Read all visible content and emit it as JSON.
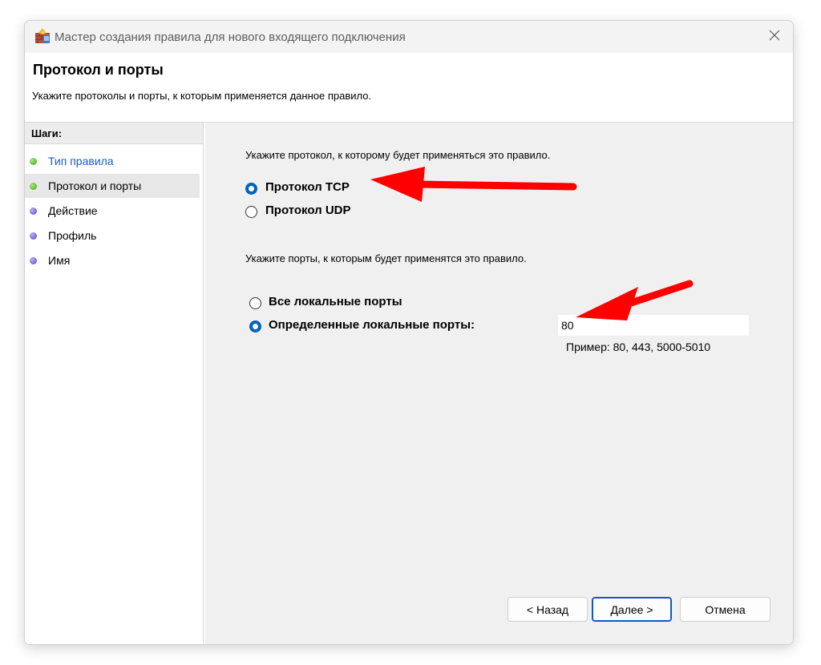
{
  "window": {
    "title": "Мастер создания правила для нового входящего подключения"
  },
  "header": {
    "title": "Протокол и порты",
    "description": "Укажите протоколы и порты, к которым применяется данное правило."
  },
  "sidebar": {
    "steps_label": "Шаги:",
    "items": [
      {
        "label": "Тип правила",
        "status": "done",
        "color": "#1a5fb4"
      },
      {
        "label": "Протокол и порты",
        "status": "current",
        "color": "#000000"
      },
      {
        "label": "Действие",
        "status": "pending",
        "color": "#000000"
      },
      {
        "label": "Профиль",
        "status": "pending",
        "color": "#000000"
      },
      {
        "label": "Имя",
        "status": "pending",
        "color": "#000000"
      }
    ]
  },
  "protocol": {
    "prompt": "Укажите протокол, к которому будет применяться это правило.",
    "options": [
      {
        "label": "Протокол TCP",
        "checked": true
      },
      {
        "label": "Протокол UDP",
        "checked": false
      }
    ]
  },
  "ports": {
    "prompt": "Укажите порты, к которым будет применятся это правило.",
    "options": [
      {
        "label": "Все локальные порты",
        "checked": false
      },
      {
        "label": "Определенные локальные порты:",
        "checked": true
      }
    ],
    "input_value": "80",
    "example": "Пример: 80, 443, 5000-5010"
  },
  "buttons": {
    "back": "< Назад",
    "next": "Далее >",
    "cancel": "Отмена"
  },
  "colors": {
    "accent": "#0062bf",
    "annotation_arrow": "#ff0000"
  },
  "icons": {
    "title": "firewall-icon",
    "close": "close-icon"
  }
}
